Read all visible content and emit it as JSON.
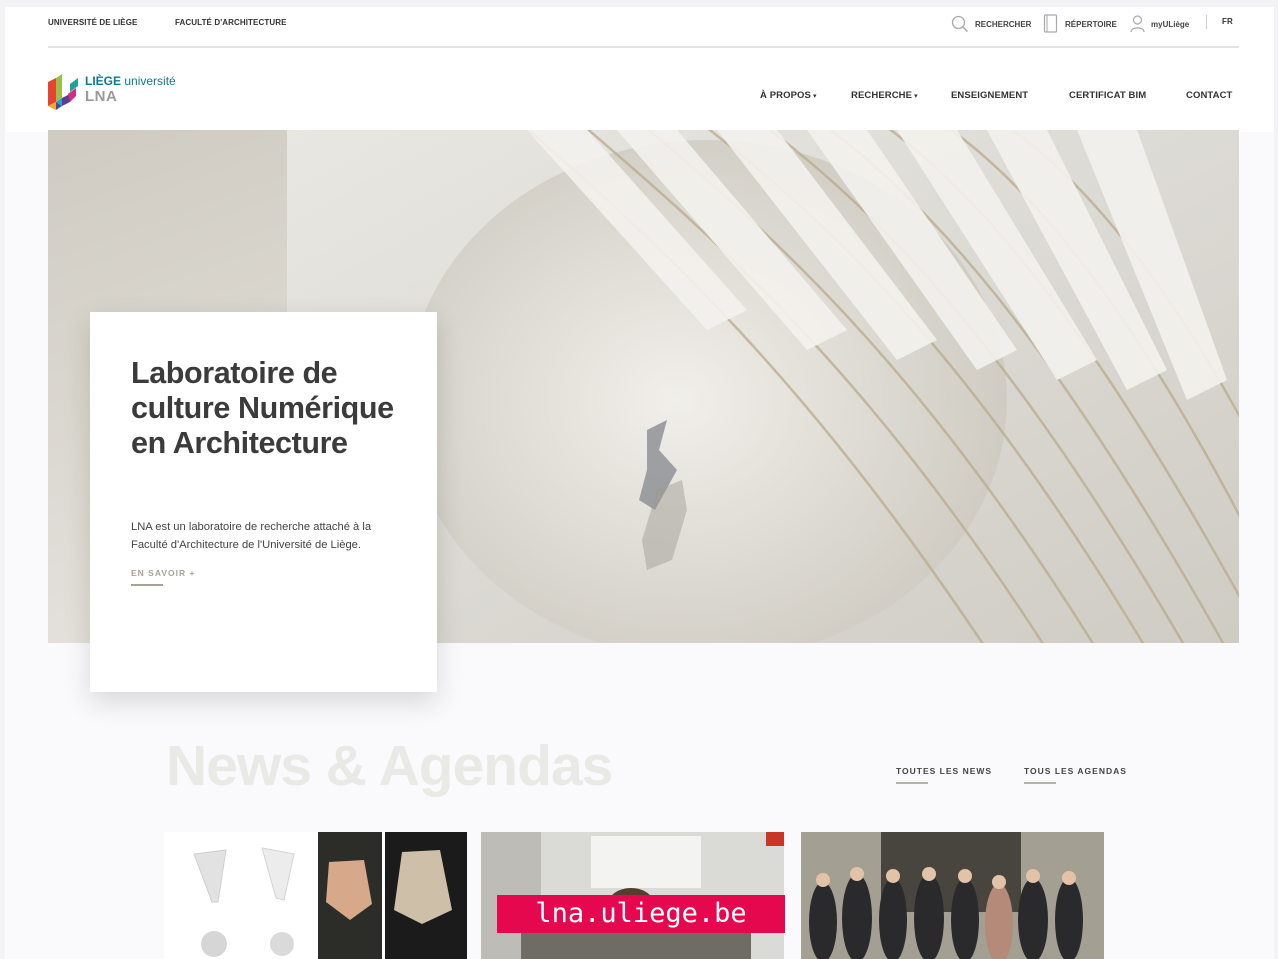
{
  "topbar": {
    "univ_link": "UNIVERSITÉ DE LIÈGE",
    "faculty_link": "FACULTÉ D'ARCHITECTURE",
    "search_label": "RECHERCHER",
    "directory_label": "RÉPERTOIRE",
    "account_label": "myULiège",
    "lang_label": "FR"
  },
  "logo": {
    "brand_strong": "LIÈGE",
    "brand_rest": "université",
    "lab": "LNA"
  },
  "nav": {
    "items": [
      {
        "label": "À PROPOS",
        "has_caret": true
      },
      {
        "label": "RECHERCHE",
        "has_caret": true
      },
      {
        "label": "ENSEIGNEMENT",
        "has_caret": false
      },
      {
        "label": "CERTIFICAT BIM",
        "has_caret": false
      },
      {
        "label": "CONTACT",
        "has_caret": false
      }
    ],
    "caret": "▾"
  },
  "hero": {
    "title": "Laboratoire de culture Numérique en Architecture",
    "description": "LNA est un laboratoire de recherche attaché à la Faculté d'Architecture de l'Université de Liège.",
    "more_label": "EN SAVOIR +"
  },
  "news": {
    "title": "News & Agendas",
    "all_news_label": "TOUTES LES NEWS",
    "all_agendas_label": "TOUS LES AGENDAS"
  },
  "url_badge": "lna.uliege.be",
  "colors": {
    "brand_teal": "#0c7b8d",
    "accent_beige": "#a9a395",
    "badge": "#e5084f"
  }
}
